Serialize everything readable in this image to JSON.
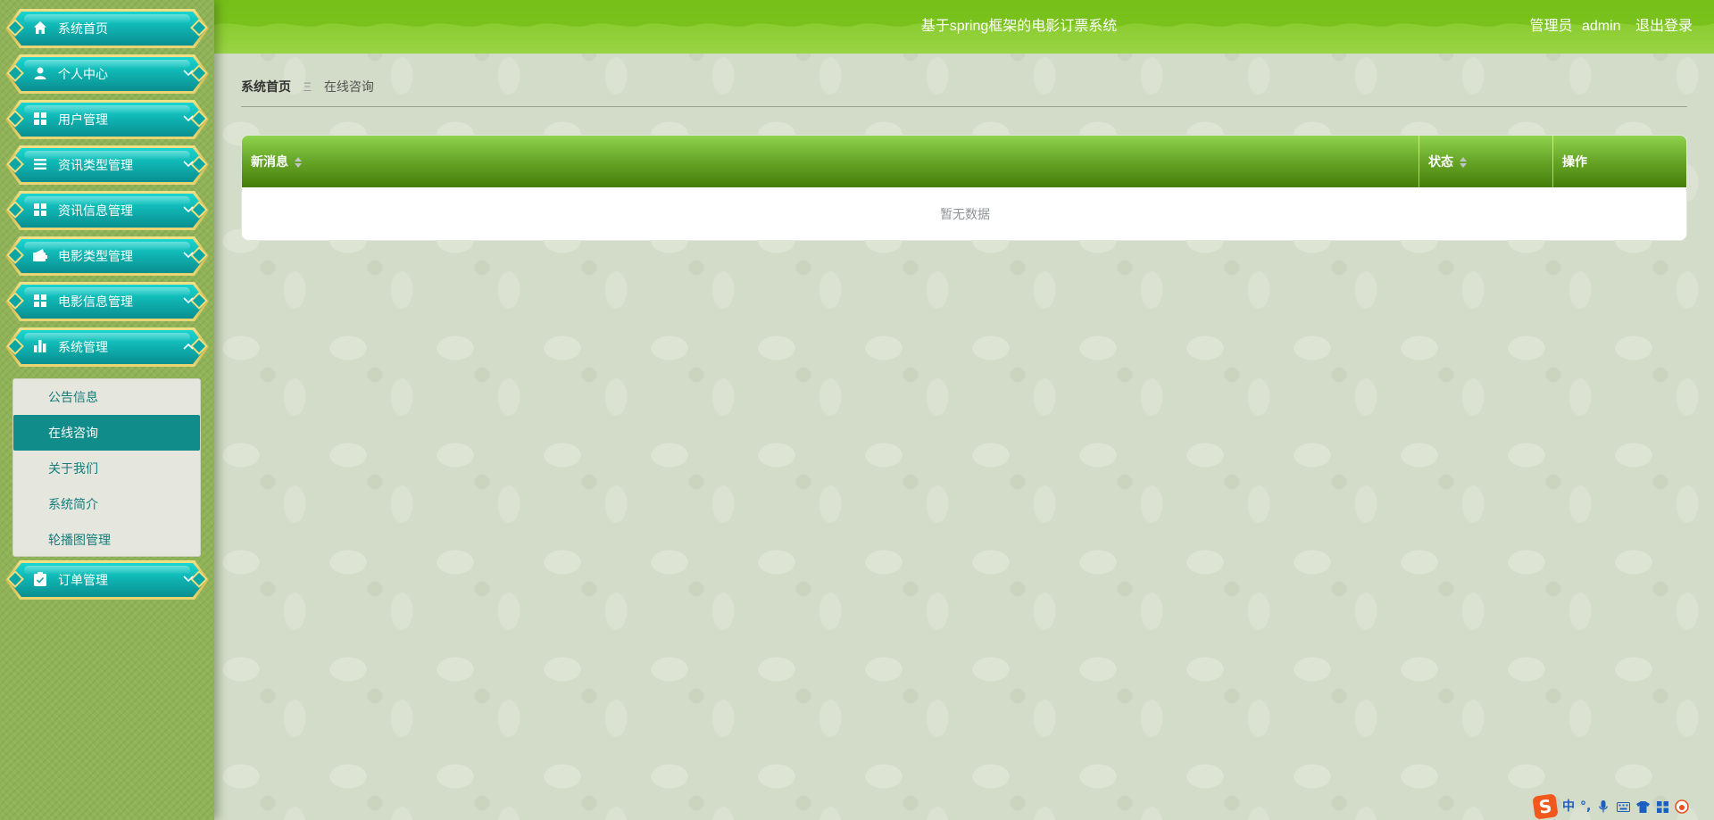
{
  "header": {
    "title": "基于spring框架的电影订票系统",
    "user_role": "管理员",
    "username": "admin",
    "logout_label": "退出登录",
    "color": "#8ccd32"
  },
  "sidebar": {
    "items": [
      {
        "label": "系统首页",
        "icon": "home-icon"
      },
      {
        "label": "个人中心",
        "icon": "user-icon"
      },
      {
        "label": "用户管理",
        "icon": "grid-icon"
      },
      {
        "label": "资讯类型管理",
        "icon": "list-icon"
      },
      {
        "label": "资讯信息管理",
        "icon": "grid-icon"
      },
      {
        "label": "电影类型管理",
        "icon": "wallet-icon"
      },
      {
        "label": "电影信息管理",
        "icon": "grid-icon"
      },
      {
        "label": "系统管理",
        "icon": "bar-chart-icon"
      },
      {
        "label": "订单管理",
        "icon": "clipboard-icon"
      }
    ],
    "submenu": [
      {
        "label": "公告信息"
      },
      {
        "label": "在线咨询"
      },
      {
        "label": "关于我们"
      },
      {
        "label": "系统简介"
      },
      {
        "label": "轮播图管理"
      }
    ],
    "active_submenu": "在线咨询",
    "accent_color": "#108c8b"
  },
  "breadcrumb": {
    "home": "系统首页",
    "separator": "Ξ",
    "current": "在线咨询"
  },
  "table": {
    "columns": [
      {
        "label": "新消息",
        "sortable": true
      },
      {
        "label": "状态",
        "sortable": true
      },
      {
        "label": "操作",
        "sortable": false
      }
    ],
    "empty_text": "暂无数据"
  },
  "ime_tray": {
    "lang": "中",
    "punct": "°,"
  }
}
